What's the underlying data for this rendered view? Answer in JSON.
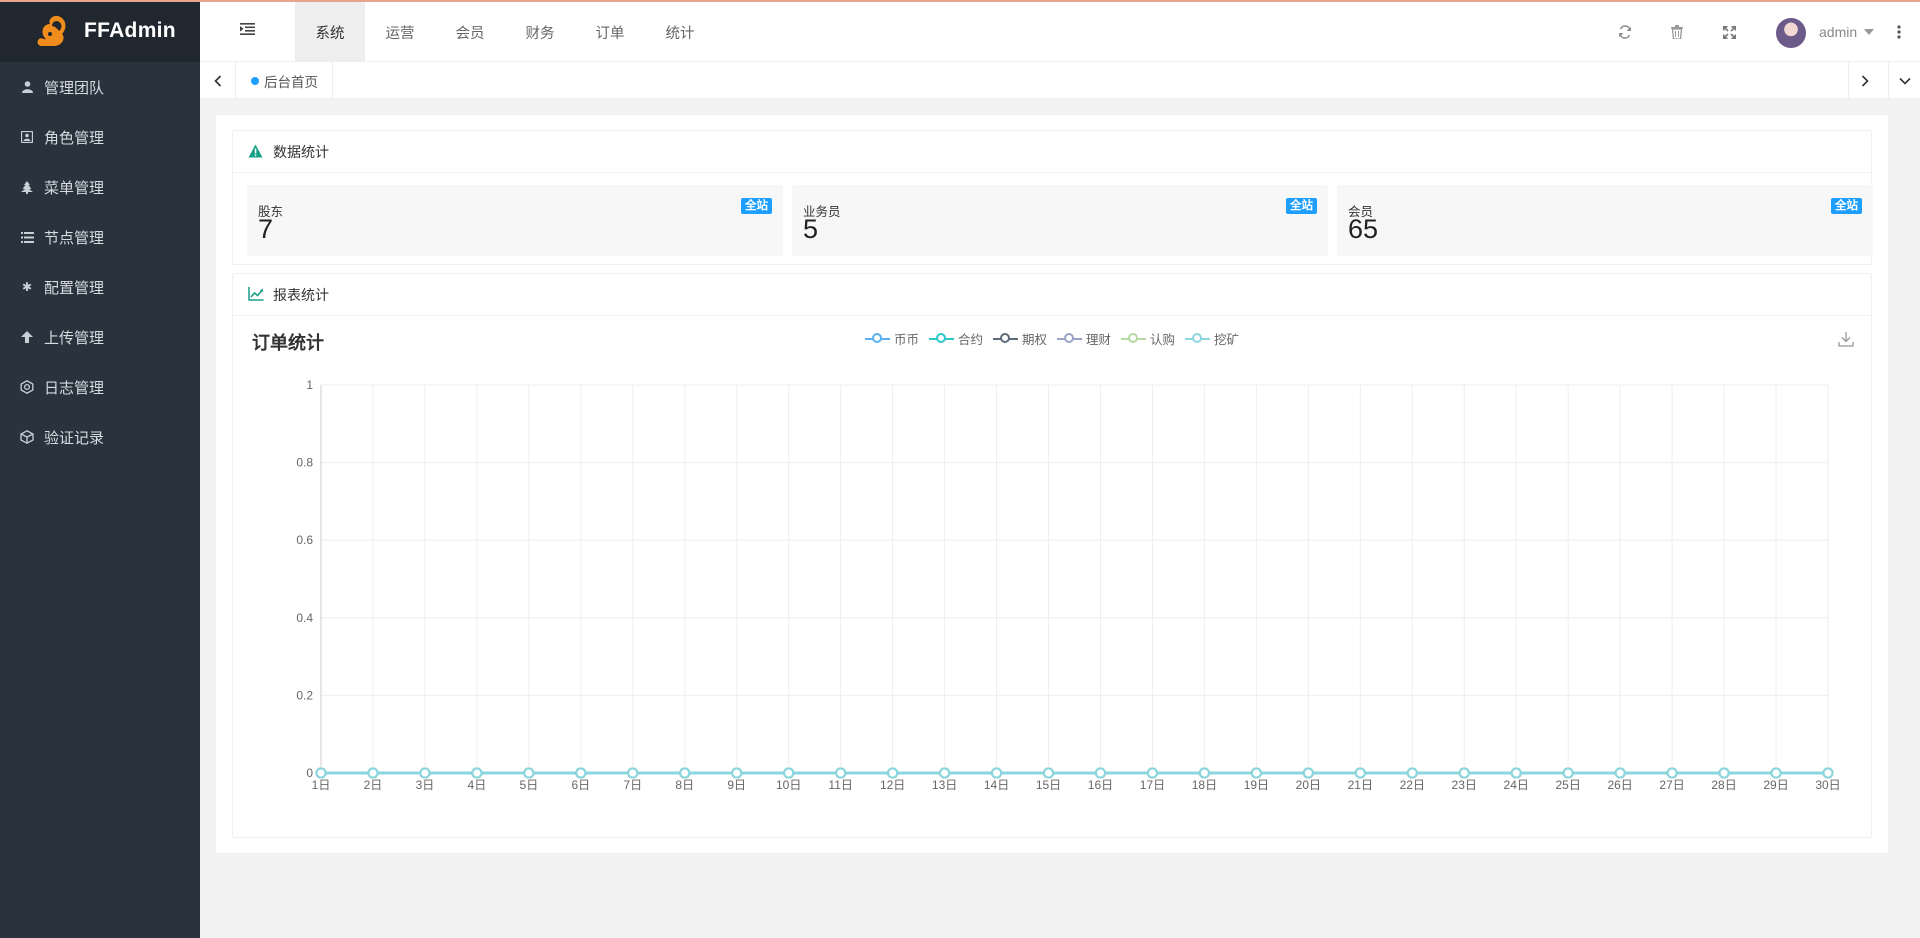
{
  "app": {
    "name": "FFAdmin"
  },
  "sidebar": {
    "items": [
      {
        "label": "管理团队",
        "icon": "user-icon"
      },
      {
        "label": "角色管理",
        "icon": "id-card-icon"
      },
      {
        "label": "菜单管理",
        "icon": "tree-icon"
      },
      {
        "label": "节点管理",
        "icon": "list-icon"
      },
      {
        "label": "配置管理",
        "icon": "asterisk-icon"
      },
      {
        "label": "上传管理",
        "icon": "upload-arrow-icon"
      },
      {
        "label": "日志管理",
        "icon": "log-icon"
      },
      {
        "label": "验证记录",
        "icon": "cube-icon"
      }
    ]
  },
  "header": {
    "tabs": [
      {
        "label": "系统",
        "active": true
      },
      {
        "label": "运营",
        "active": false
      },
      {
        "label": "会员",
        "active": false
      },
      {
        "label": "财务",
        "active": false
      },
      {
        "label": "订单",
        "active": false
      },
      {
        "label": "统计",
        "active": false
      }
    ],
    "icons": [
      "refresh-icon",
      "trash-icon",
      "fullscreen-icon",
      "more-vertical-icon"
    ],
    "username": "admin"
  },
  "tabbar": {
    "current_page": "后台首页"
  },
  "stats": {
    "title": "数据统计",
    "items": [
      {
        "label": "股东",
        "value": "7",
        "badge": "全站"
      },
      {
        "label": "业务员",
        "value": "5",
        "badge": "全站"
      },
      {
        "label": "会员",
        "value": "65",
        "badge": "全站"
      }
    ]
  },
  "report": {
    "title": "报表统计"
  },
  "colors": {
    "sidebar_bg": "#28333e",
    "logo_bg": "#20272e",
    "badge": "#1e9fff",
    "accent_green": "#16a085"
  },
  "chart_data": {
    "type": "line",
    "title": "订单统计",
    "categories": [
      "1日",
      "2日",
      "3日",
      "4日",
      "5日",
      "6日",
      "7日",
      "8日",
      "9日",
      "10日",
      "11日",
      "12日",
      "13日",
      "14日",
      "15日",
      "16日",
      "17日",
      "18日",
      "19日",
      "20日",
      "21日",
      "22日",
      "23日",
      "24日",
      "25日",
      "26日",
      "27日",
      "28日",
      "29日",
      "30日"
    ],
    "series": [
      {
        "name": "币币",
        "color": "#5ab1ef",
        "values": [
          0,
          0,
          0,
          0,
          0,
          0,
          0,
          0,
          0,
          0,
          0,
          0,
          0,
          0,
          0,
          0,
          0,
          0,
          0,
          0,
          0,
          0,
          0,
          0,
          0,
          0,
          0,
          0,
          0,
          0
        ]
      },
      {
        "name": "合约",
        "color": "#2ec7c9",
        "values": [
          0,
          0,
          0,
          0,
          0,
          0,
          0,
          0,
          0,
          0,
          0,
          0,
          0,
          0,
          0,
          0,
          0,
          0,
          0,
          0,
          0,
          0,
          0,
          0,
          0,
          0,
          0,
          0,
          0,
          0
        ]
      },
      {
        "name": "期权",
        "color": "#5d6a7a",
        "values": [
          0,
          0,
          0,
          0,
          0,
          0,
          0,
          0,
          0,
          0,
          0,
          0,
          0,
          0,
          0,
          0,
          0,
          0,
          0,
          0,
          0,
          0,
          0,
          0,
          0,
          0,
          0,
          0,
          0,
          0
        ]
      },
      {
        "name": "理财",
        "color": "#9aa3c6",
        "values": [
          0,
          0,
          0,
          0,
          0,
          0,
          0,
          0,
          0,
          0,
          0,
          0,
          0,
          0,
          0,
          0,
          0,
          0,
          0,
          0,
          0,
          0,
          0,
          0,
          0,
          0,
          0,
          0,
          0,
          0
        ]
      },
      {
        "name": "认购",
        "color": "#b6d9a3",
        "values": [
          0,
          0,
          0,
          0,
          0,
          0,
          0,
          0,
          0,
          0,
          0,
          0,
          0,
          0,
          0,
          0,
          0,
          0,
          0,
          0,
          0,
          0,
          0,
          0,
          0,
          0,
          0,
          0,
          0,
          0
        ]
      },
      {
        "name": "挖矿",
        "color": "#8ad7e0",
        "values": [
          0,
          0,
          0,
          0,
          0,
          0,
          0,
          0,
          0,
          0,
          0,
          0,
          0,
          0,
          0,
          0,
          0,
          0,
          0,
          0,
          0,
          0,
          0,
          0,
          0,
          0,
          0,
          0,
          0,
          0
        ]
      }
    ],
    "ylim": [
      0,
      1
    ],
    "yticks": [
      "0",
      "0.2",
      "0.4",
      "0.6",
      "0.8",
      "1"
    ],
    "grid": true,
    "legend": "top-center"
  }
}
